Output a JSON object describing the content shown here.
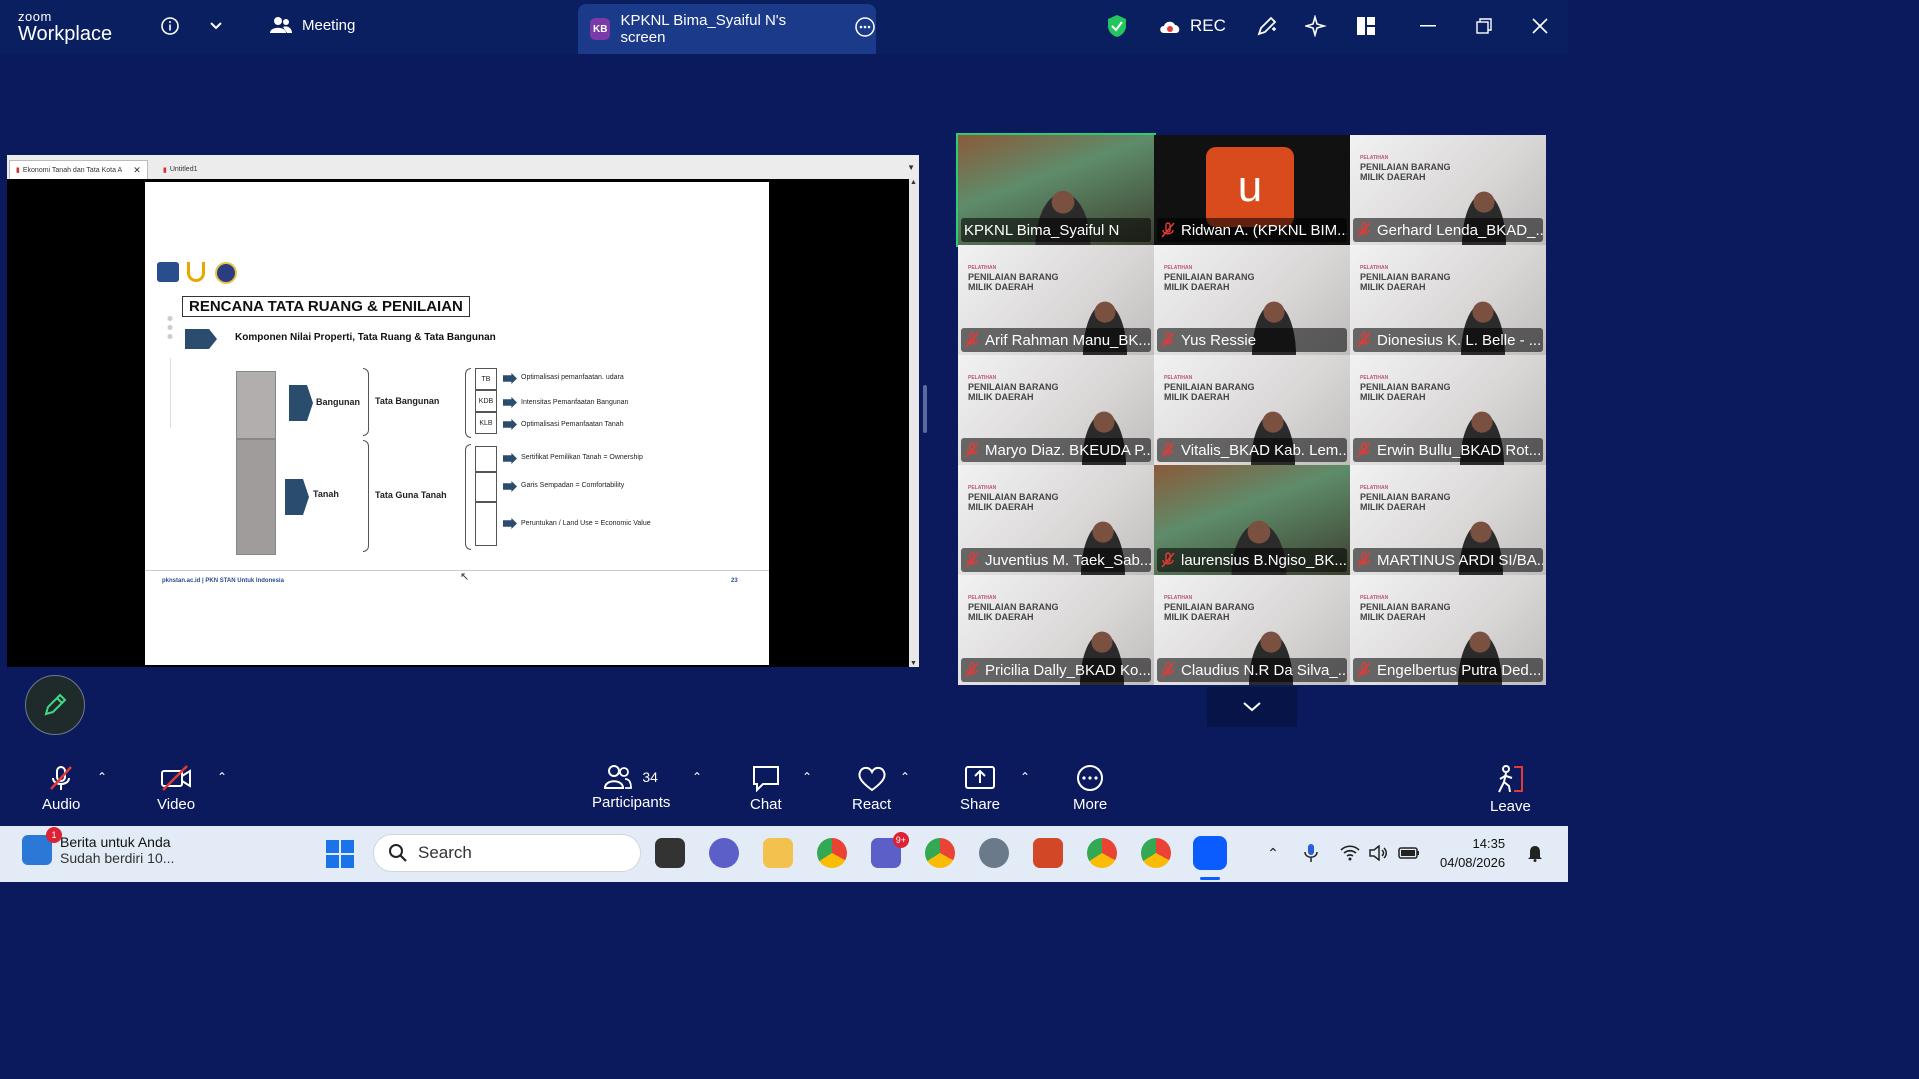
{
  "app": {
    "brand_small": "zoom",
    "brand_name": "Workplace"
  },
  "topbar": {
    "meeting_label": "Meeting",
    "share_initials": "KB",
    "share_title": "KPKNL Bima_Syaiful N's screen",
    "rec_label": "REC"
  },
  "shared_screen": {
    "tabs": [
      "Ekonomi Tanah dan Tata Kota A",
      "Untitled1"
    ],
    "slide": {
      "title": "RENCANA TATA RUANG & PENILAIAN",
      "subtitle": "Komponen Nilai Properti, Tata Ruang & Tata Bangunan",
      "label_bangunan": "Bangunan",
      "label_tanah": "Tanah",
      "label_tata_bangunan": "Tata Bangunan",
      "label_tata_guna_tanah": "Tata Guna Tanah",
      "cells": [
        "TB",
        "KDB",
        "KLB"
      ],
      "items_top": [
        "Optimalisasi pemanfaatan. udara",
        "Intensitas Pemanfaatan Bangunan",
        "Optimalisasi Pemanfaatan Tanah"
      ],
      "items_bottom": [
        "Sertifikat Pemilikan Tanah = Ownership",
        "Garis Sempadan = Comfortability",
        "Peruntukan / Land Use = Economic Value"
      ],
      "footer_left": "pknstan.ac.id | PKN STAN Untuk Indonesia",
      "page_number": "23"
    }
  },
  "gallery": {
    "banner": {
      "pre": "PELATIHAN",
      "line1": "PENILAIAN BARANG",
      "line2": "MILIK DAERAH"
    },
    "participants": [
      {
        "name": "KPKNL Bima_Syaiful N",
        "muted": false,
        "type": "camera"
      },
      {
        "name": "Ridwan A. (KPKNL BIM...",
        "muted": true,
        "type": "avatar",
        "initial": "u"
      },
      {
        "name": "Gerhard Lenda_BKAD_...",
        "muted": true,
        "type": "banner"
      },
      {
        "name": "Arif Rahman Manu_BK...",
        "muted": true,
        "type": "banner"
      },
      {
        "name": "Yus Ressie",
        "muted": true,
        "type": "banner"
      },
      {
        "name": "Dionesius K. L. Belle - ...",
        "muted": true,
        "type": "banner"
      },
      {
        "name": "Maryo Diaz. BKEUDA P...",
        "muted": true,
        "type": "banner"
      },
      {
        "name": "Vitalis_BKAD Kab. Lem...",
        "muted": true,
        "type": "banner"
      },
      {
        "name": "Erwin Bullu_BKAD Rot...",
        "muted": true,
        "type": "banner"
      },
      {
        "name": "Juventius M. Taek_Sab...",
        "muted": true,
        "type": "banner"
      },
      {
        "name": "laurensius B.Ngiso_BK...",
        "muted": true,
        "type": "camera2"
      },
      {
        "name": "MARTINUS ARDI SI/BA...",
        "muted": true,
        "type": "banner"
      },
      {
        "name": "Pricilia Dally_BKAD Ko...",
        "muted": true,
        "type": "banner"
      },
      {
        "name": "Claudius N.R Da Silva_...",
        "muted": true,
        "type": "banner"
      },
      {
        "name": "Engelbertus Putra Ded...",
        "muted": true,
        "type": "banner"
      }
    ]
  },
  "controls": {
    "audio": "Audio",
    "video": "Video",
    "participants": "Participants",
    "participants_count": "34",
    "chat": "Chat",
    "react": "React",
    "share": "Share",
    "more": "More",
    "leave": "Leave"
  },
  "taskbar": {
    "news_title": "Berita untuk Anda",
    "news_sub": "Sudah berdiri 10...",
    "news_badge": "1",
    "search_placeholder": "Search",
    "teams_badge": "9+",
    "time": "14:35",
    "date": "04/08/2026"
  },
  "colors": {
    "accent": "#0b5cff",
    "bg": "#0b1a5c",
    "tile_border_active": "#2ecc71"
  }
}
